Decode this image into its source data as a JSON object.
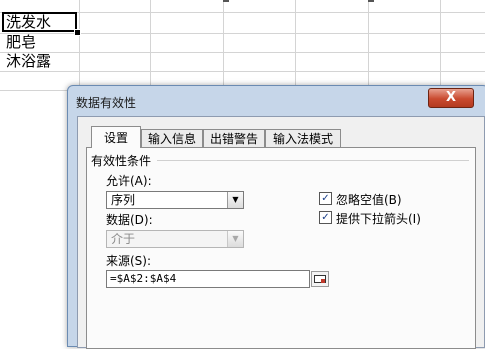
{
  "sheet": {
    "cells": [
      "洗发水",
      "肥皂",
      "沐浴露"
    ]
  },
  "dialog": {
    "title": "数据有效性",
    "close_label": "X",
    "tabs": [
      {
        "label": "设置"
      },
      {
        "label": "输入信息"
      },
      {
        "label": "出错警告"
      },
      {
        "label": "输入法模式"
      }
    ],
    "section_title": "有效性条件",
    "allow_label": "允许(A):",
    "allow_value": "序列",
    "data_label": "数据(D):",
    "data_value": "介于",
    "ignore_blank_label": "忽略空值(B)",
    "ignore_blank_checked": true,
    "dropdown_label": "提供下拉箭头(I)",
    "dropdown_checked": true,
    "source_label": "来源(S):",
    "source_value": "=$A$2:$A$4"
  },
  "colors": {
    "dialog_frame": "#c6d6e9",
    "close_button": "#c94a2f",
    "checkmark": "#1a3f8a"
  }
}
